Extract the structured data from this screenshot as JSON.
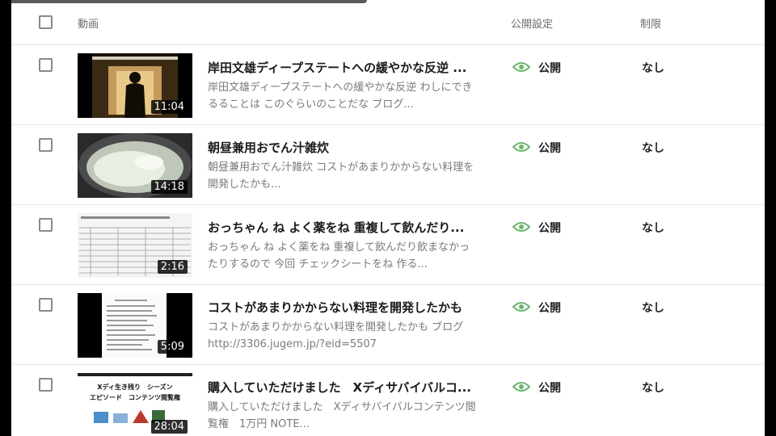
{
  "header": {
    "video_label": "動画",
    "visibility_label": "公開設定",
    "restriction_label": "制限"
  },
  "colors": {
    "visibility_icon": "#6db36d"
  },
  "videos": [
    {
      "title": "岸田文雄ディープステートへの緩やかな反逆 ...",
      "description": "岸田文雄ディープステートへの緩やかな反逆 わしにできるることは このぐらいのことだな ブログ...",
      "duration": "11:04",
      "visibility": "公開",
      "restriction": "なし",
      "thumbnail": "silhouette-in-doorway"
    },
    {
      "title": "朝昼兼用おでん汁雑炊",
      "description": "朝昼兼用おでん汁雑炊 コストがあまりかからない料理を開発したかも...",
      "duration": "14:18",
      "visibility": "公開",
      "restriction": "なし",
      "thumbnail": "pot-of-porridge"
    },
    {
      "title": "おっちゃん ね よく薬をね 重複して飲んだり...",
      "description": "おっちゃん ね よく薬をね 重複して飲んだり飲まなかったりするので 今回 チェックシートをね 作る...",
      "duration": "2:16",
      "visibility": "公開",
      "restriction": "なし",
      "thumbnail": "check-sheet"
    },
    {
      "title": "コストがあまりかからない料理を開発したかも",
      "description": "コストがあまりかからない料理を開発したかも ブログ　　http://3306.jugem.jp/?eid=5507",
      "duration": "5:09",
      "visibility": "公開",
      "restriction": "なし",
      "thumbnail": "text-document"
    },
    {
      "title": "購入していただけました　Xディサバイバルコ...",
      "description": "購入していただけました　Xディサバイバルコンテンツ閲覧権　1万円 NOTE...",
      "duration": "28:04",
      "visibility": "公開",
      "restriction": "なし",
      "thumbnail": "content-banner",
      "thumb_text_line1": "Xディ生き残り　シーズン",
      "thumb_text_line2": "エピソード　コンテンツ閲覧権"
    }
  ]
}
